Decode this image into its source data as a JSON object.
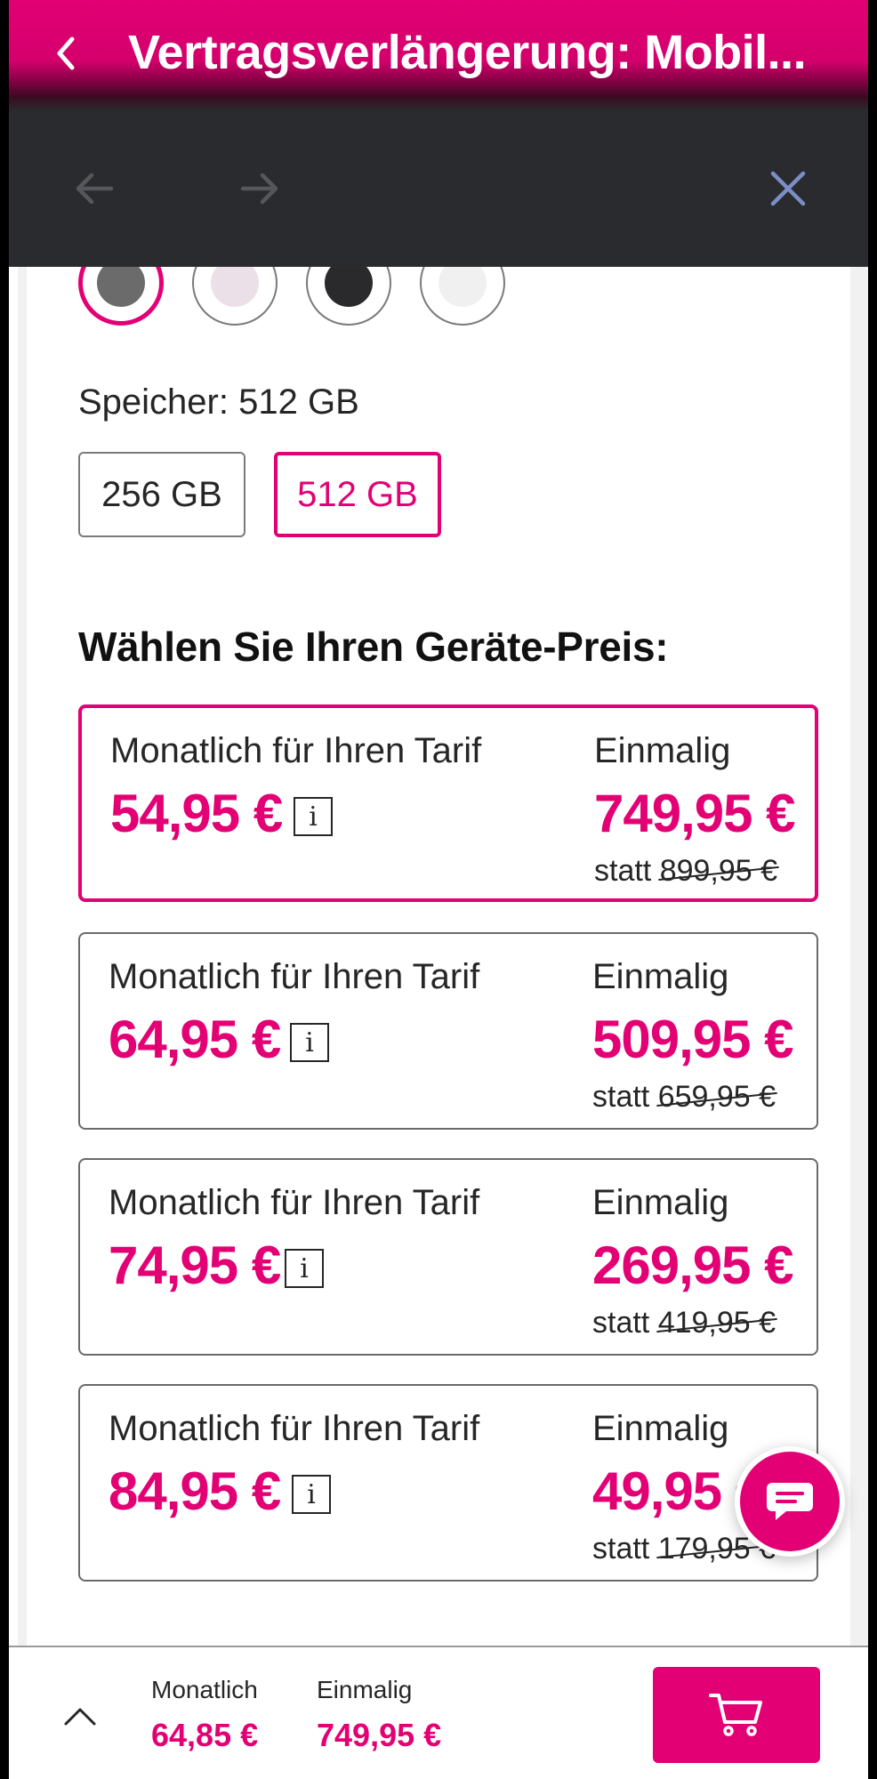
{
  "header": {
    "title": "Vertragsverlängerung: Mobil...",
    "back_icon": "chevron-left-icon"
  },
  "toolbar": {
    "back_icon": "arrow-left-icon",
    "forward_icon": "arrow-right-icon",
    "close_icon": "close-icon"
  },
  "colors": {
    "magenta": "#e20074",
    "swatches": [
      "#6b6b6b",
      "#ece0e8",
      "#2a2a2c",
      "#f0f0f0"
    ]
  },
  "storage": {
    "label": "Speicher: 512 GB",
    "options": [
      "256 GB",
      "512 GB"
    ],
    "selected": "512 GB"
  },
  "section_title": "Wählen Sie Ihren Geräte-Preis:",
  "price_options": [
    {
      "monthly_label": "Monatlich für Ihren Tarif",
      "monthly": "54,95 €",
      "once_label": "Einmalig",
      "once": "749,95 €",
      "statt": "statt",
      "old": "899,95 €",
      "selected": true
    },
    {
      "monthly_label": "Monatlich für Ihren Tarif",
      "monthly": "64,95 €",
      "once_label": "Einmalig",
      "once": "509,95 €",
      "statt": "statt",
      "old": "659,95 €",
      "selected": false
    },
    {
      "monthly_label": "Monatlich für Ihren Tarif",
      "monthly": "74,95 €",
      "once_label": "Einmalig",
      "once": "269,95 €",
      "statt": "statt",
      "old": "419,95 €",
      "selected": false
    },
    {
      "monthly_label": "Monatlich für Ihren Tarif",
      "monthly": "84,95 €",
      "once_label": "Einmalig",
      "once": "49,95 €",
      "statt": "statt",
      "old": "179,95 €",
      "selected": false
    }
  ],
  "info_glyph": "i",
  "bottom_bar": {
    "monthly_label": "Monatlich",
    "monthly_value": "64,85 €",
    "once_label": "Einmalig",
    "once_value": "749,95 €",
    "cart_icon": "cart-icon",
    "expand_icon": "chevron-up-icon"
  },
  "chat_icon": "chat-icon"
}
